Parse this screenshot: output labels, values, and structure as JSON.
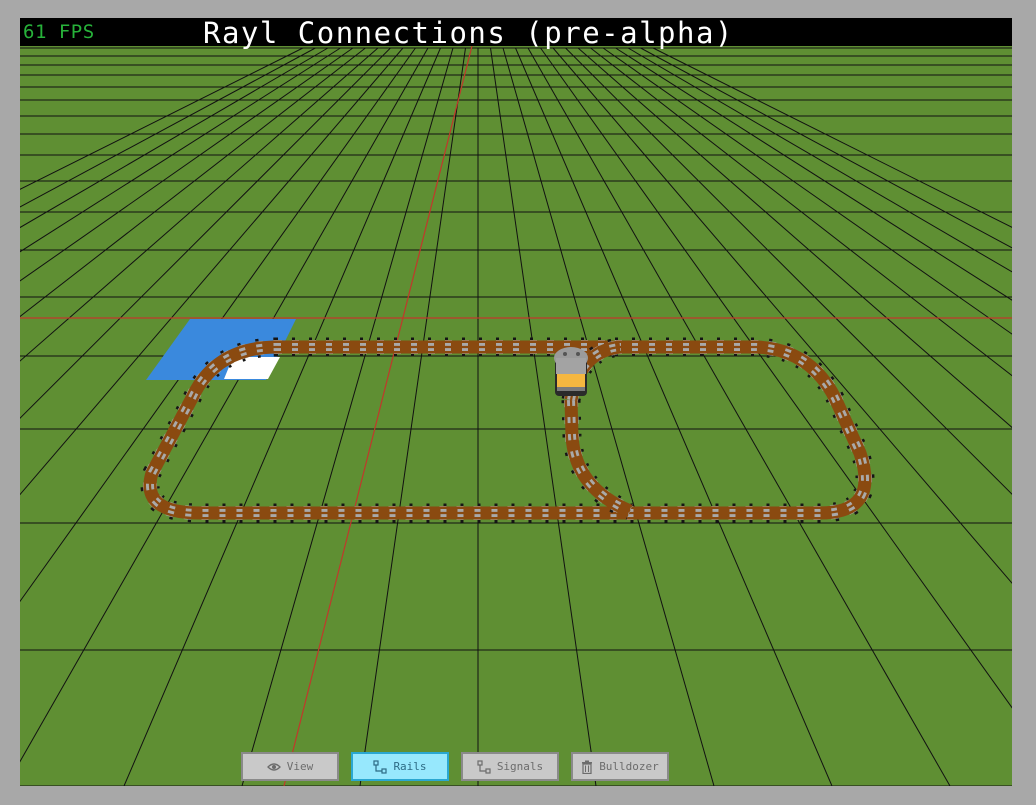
{
  "app": {
    "title": "Rayl Connections (pre-alpha)",
    "fps": "61 FPS"
  },
  "scene": {
    "ground_color": "#5f8f33",
    "grid_line_color": "#111111",
    "axis_line_color": "#c0392b",
    "selection_color": "#3a89dd",
    "highlight_tile_color": "#ffffff",
    "rail_color": "#8a4a10",
    "sleeper_color": "#a9a9a9"
  },
  "toolbar": {
    "active": "Rails",
    "buttons": [
      {
        "label": "View",
        "icon": "eye-icon"
      },
      {
        "label": "Rails",
        "icon": "rails-icon"
      },
      {
        "label": "Signals",
        "icon": "signals-icon"
      },
      {
        "label": "Bulldozer",
        "icon": "trash-icon"
      }
    ]
  }
}
